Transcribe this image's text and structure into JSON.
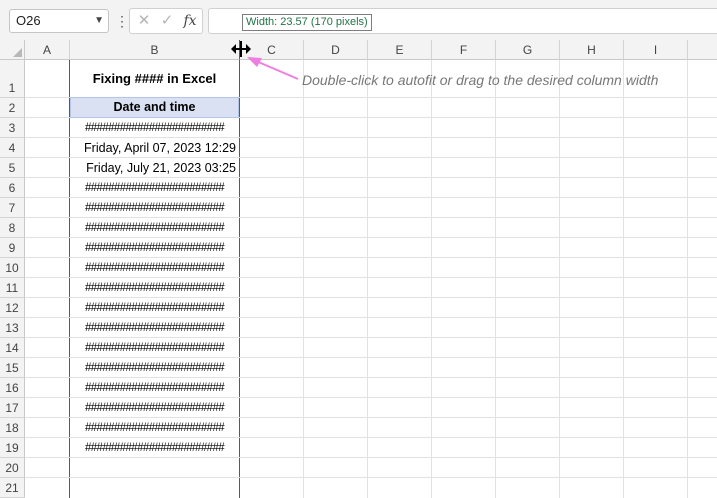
{
  "formula_bar": {
    "name_box": "O26",
    "cancel_icon": "✕",
    "enter_icon": "✓",
    "fx_label": "fx",
    "formula_value": ""
  },
  "tooltip": "Width: 23.57 (170 pixels)",
  "columns": [
    "A",
    "B",
    "C",
    "D",
    "E",
    "F",
    "G",
    "H",
    "I"
  ],
  "rows": [
    "1",
    "2",
    "3",
    "4",
    "5",
    "6",
    "7",
    "8",
    "9",
    "10",
    "11",
    "12",
    "13",
    "14",
    "15",
    "16",
    "17",
    "18",
    "19",
    "20",
    "21"
  ],
  "cells": {
    "B1": "Fixing #### in Excel",
    "B2": "Date and time",
    "B3": "########################",
    "B4": "Friday, April 07, 2023 12:29",
    "B5": "Friday, July 21, 2023 03:25",
    "B6": "########################",
    "B7": "########################",
    "B8": "########################",
    "B9": "########################",
    "B10": "########################",
    "B11": "########################",
    "B12": "########################",
    "B13": "########################",
    "B14": "########################",
    "B15": "########################",
    "B16": "########################",
    "B17": "########################",
    "B18": "########################",
    "B19": "########################"
  },
  "annotation": "Double-click to autofit or drag to the desired column width",
  "colors": {
    "header_fill": "#d9e1f2",
    "annotation_arrow": "#f07ee0",
    "tooltip_text": "#217346"
  },
  "icons": {
    "cursor": "column-resize-cursor-icon",
    "arrow": "annotation-arrow-icon"
  }
}
